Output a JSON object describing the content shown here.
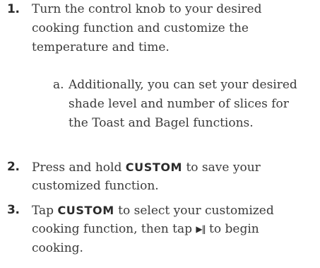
{
  "steps": [
    {
      "number": "1.",
      "lines": [
        "Turn the control knob to your desired",
        "cooking function and customize the",
        "temperature and time."
      ],
      "substeps": [
        {
          "letter": "a.",
          "lines": [
            "Additionally, you can set your desired",
            "shade level and number of slices for",
            "the Toast and Bagel functions."
          ]
        }
      ]
    },
    {
      "number": "2.",
      "line1_before": "Press and hold ",
      "keyword": "CUSTOM",
      "line1_after": " to save your",
      "line2": "customized function."
    },
    {
      "number": "3.",
      "line1_before": "Tap ",
      "keyword": "CUSTOM",
      "line1_after": " to select your customized",
      "line2_before": "cooking function, then tap ",
      "play_pause_symbol": "▶‖",
      "play_pause_icon": "play-pause-icon",
      "line2_after": " to begin",
      "line3": "cooking."
    }
  ]
}
